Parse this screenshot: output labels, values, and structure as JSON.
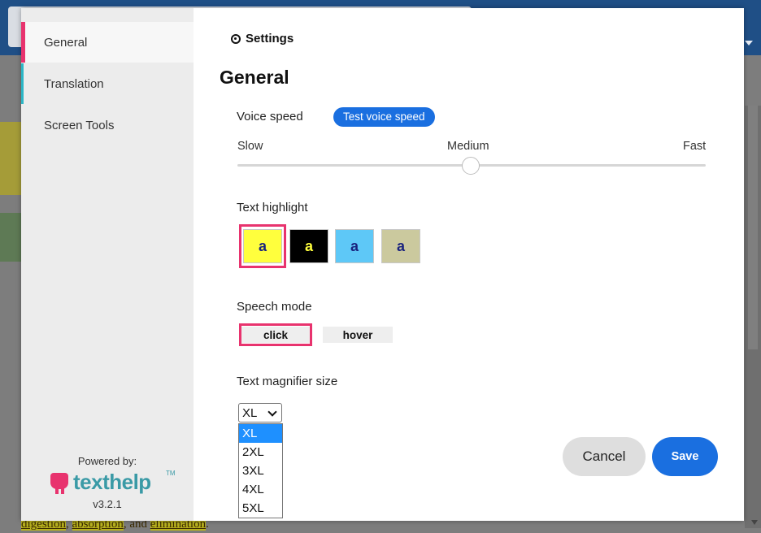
{
  "sidebar": {
    "items": [
      {
        "label": "General"
      },
      {
        "label": "Translation"
      },
      {
        "label": "Screen Tools"
      }
    ],
    "powered_by": "Powered by:",
    "logo_text": "texthelp",
    "logo_tm": "TM",
    "version": "v3.2.1"
  },
  "header": {
    "settings": "Settings",
    "title": "General"
  },
  "voice": {
    "label": "Voice speed",
    "test_button": "Test voice speed",
    "slow": "Slow",
    "medium": "Medium",
    "fast": "Fast",
    "value": "Medium"
  },
  "highlight": {
    "label": "Text highlight",
    "swatches": [
      {
        "letter": "a",
        "bg": "#ffff3d",
        "fg": "#1a237e"
      },
      {
        "letter": "a",
        "bg": "#000000",
        "fg": "#ffff3d"
      },
      {
        "letter": "a",
        "bg": "#5ec8f7",
        "fg": "#1a237e"
      },
      {
        "letter": "a",
        "bg": "#cbc99e",
        "fg": "#1a237e"
      }
    ],
    "selected_index": 0
  },
  "speech": {
    "label": "Speech mode",
    "click": "click",
    "hover": "hover",
    "selected": "click"
  },
  "magnifier": {
    "label": "Text magnifier size",
    "value": "XL",
    "options": [
      "XL",
      "2XL",
      "3XL",
      "4XL",
      "5XL"
    ]
  },
  "actions": {
    "cancel": "Cancel",
    "save": "Save"
  },
  "background": {
    "text_1": "digestion",
    "text_2": ", ",
    "text_3": "absorption",
    "text_4": ", and ",
    "text_5": "elimination",
    "text_6": "."
  },
  "colors": {
    "accent": "#e8336e",
    "primary": "#1a6fe0",
    "teal": "#2cb6c6"
  }
}
